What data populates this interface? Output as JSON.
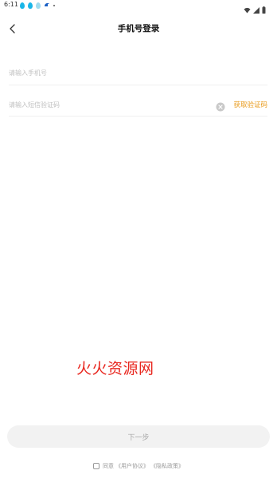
{
  "status_bar": {
    "time": "6:11",
    "icons_left": [
      "drop-icon",
      "drop-icon",
      "cloud-icon",
      "app-icon",
      "dot-icon"
    ],
    "icons_right": [
      "wifi-icon",
      "signal-icon",
      "battery-icon"
    ]
  },
  "header": {
    "back_icon": "chevron-left-icon",
    "title": "手机号登录"
  },
  "form": {
    "phone_placeholder": "请输入手机号",
    "code_placeholder": "请输入短信验证码",
    "clear_icon": "clear-icon",
    "get_code_label": "获取验证码"
  },
  "watermark": "火火资源网",
  "actions": {
    "next_label": "下一步"
  },
  "agreement": {
    "prefix": "同意",
    "user_agreement": "《用户协议》",
    "privacy_policy": "《隐私政策》"
  },
  "colors": {
    "accent": "#e89a1a",
    "watermark": "#e8261e",
    "button_bg": "#f2f2f2",
    "button_text": "#a8a8a8"
  }
}
